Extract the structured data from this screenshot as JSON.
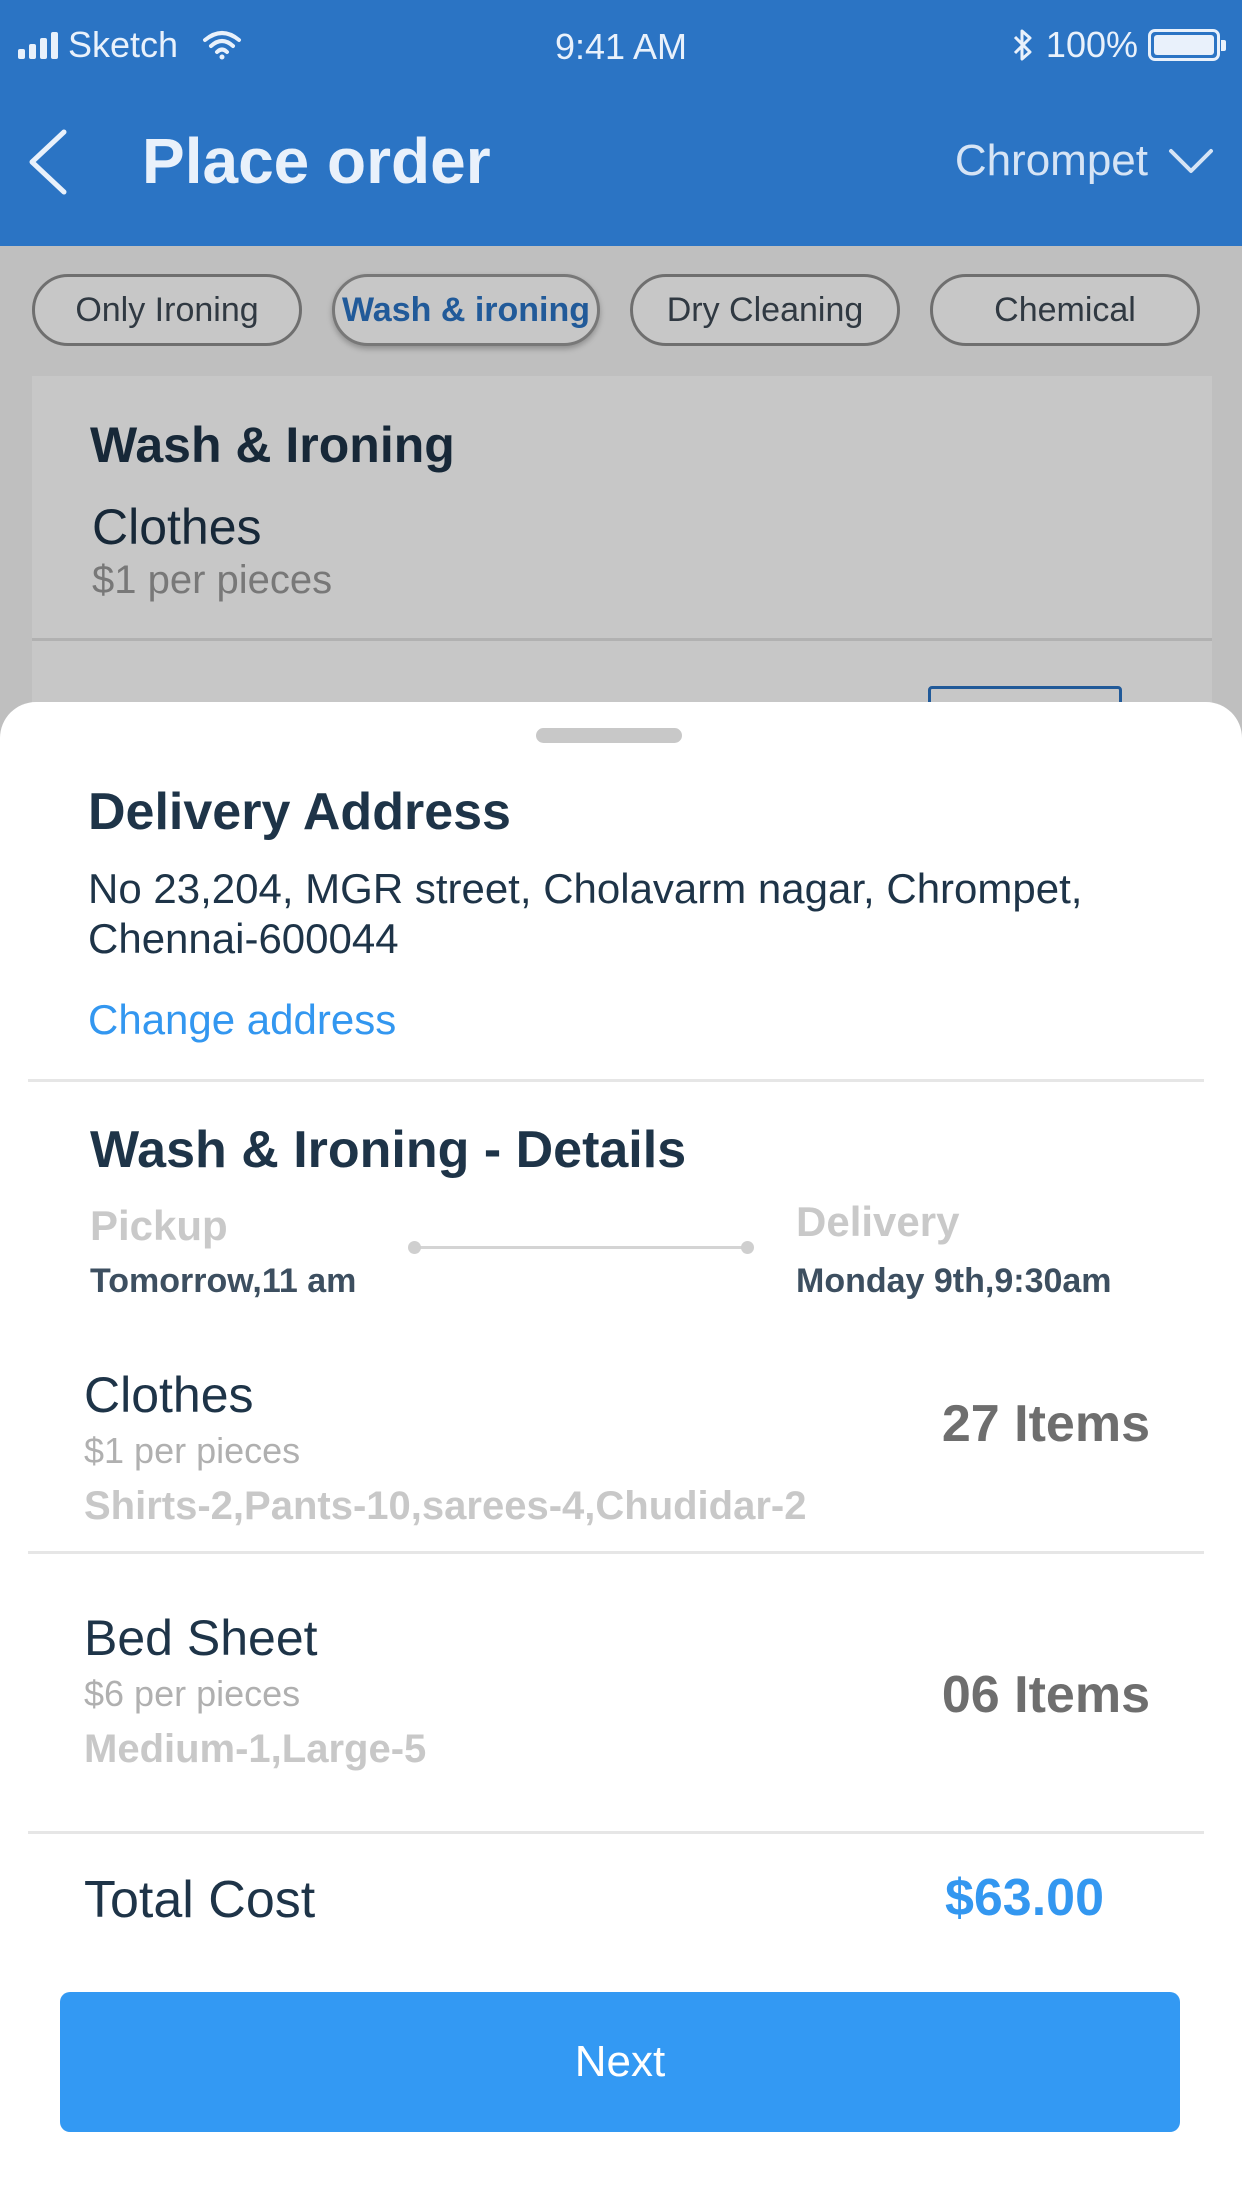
{
  "status_bar": {
    "carrier": "Sketch",
    "time": "9:41 AM",
    "battery": "100%"
  },
  "header": {
    "title": "Place order",
    "location": "Chrompet",
    "icons": {
      "back": "chevron-left-icon",
      "dropdown": "chevron-down-icon"
    }
  },
  "service_tabs": [
    {
      "label": "Only Ironing",
      "active": false
    },
    {
      "label": "Wash & ironing",
      "active": true
    },
    {
      "label": "Dry Cleaning",
      "active": false
    },
    {
      "label": "Chemical",
      "active": false
    }
  ],
  "background_card": {
    "title": "Wash & Ironing",
    "item_name": "Clothes",
    "item_price": "$1 per pieces"
  },
  "sheet": {
    "address": {
      "title": "Delivery Address",
      "text": "No 23,204, MGR street, Cholavarm nagar, Chrompet, Chennai-600044",
      "change_link": "Change address"
    },
    "details": {
      "title": "Wash & Ironing - Details",
      "pickup_label": "Pickup",
      "pickup_value": "Tomorrow,11 am",
      "delivery_label": "Delivery",
      "delivery_value": "Monday 9th,9:30am"
    },
    "items": [
      {
        "name": "Clothes",
        "price": "$1 per pieces",
        "breakdown": "Shirts-2,Pants-10,sarees-4,Chudidar-2",
        "count": "27 Items"
      },
      {
        "name": "Bed Sheet",
        "price": "$6 per pieces",
        "breakdown": "Medium-1,Large-5",
        "count": "06 Items"
      }
    ],
    "total": {
      "label": "Total Cost",
      "value": "$63.00"
    },
    "next_button": "Next"
  },
  "colors": {
    "header_bg": "#2b74c4",
    "accent": "#3397f0",
    "button_bg": "#3399f3",
    "text_dark": "#1e3448"
  }
}
